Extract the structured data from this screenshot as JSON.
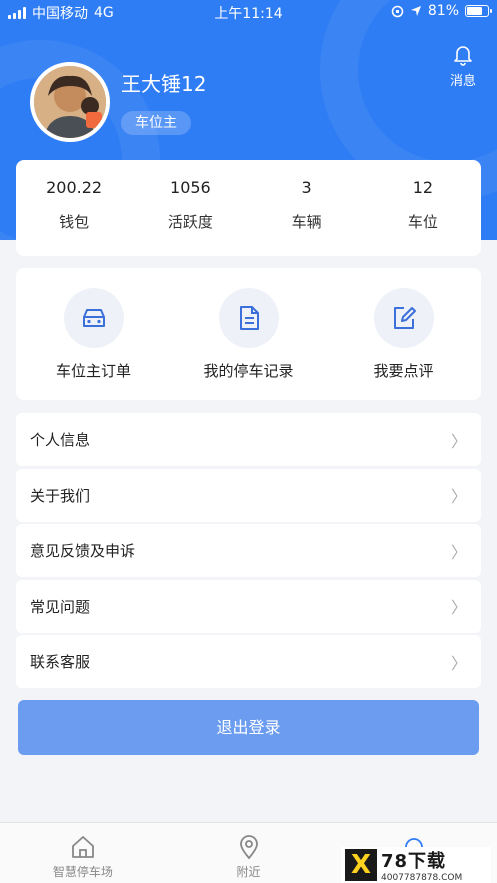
{
  "status_bar": {
    "carrier": "中国移动",
    "network": "4G",
    "time": "上午11:14",
    "battery_text": "81%",
    "battery_level": 0.81
  },
  "header": {
    "message_label": "消息",
    "username": "王大锤12",
    "role": "车位主"
  },
  "stats": [
    {
      "value": "200.22",
      "label": "钱包"
    },
    {
      "value": "1056",
      "label": "活跃度"
    },
    {
      "value": "3",
      "label": "车辆"
    },
    {
      "value": "12",
      "label": "车位"
    }
  ],
  "actions": [
    {
      "label": "车位主订单",
      "icon": "car-icon"
    },
    {
      "label": "我的停车记录",
      "icon": "document-icon"
    },
    {
      "label": "我要点评",
      "icon": "edit-icon"
    }
  ],
  "menu": [
    {
      "label": "个人信息"
    },
    {
      "label": "关于我们"
    },
    {
      "label": "意见反馈及申诉"
    },
    {
      "label": "常见问题"
    },
    {
      "label": "联系客服"
    }
  ],
  "logout_label": "退出登录",
  "tabbar": [
    {
      "label": "智慧停车场",
      "icon": "home-icon"
    },
    {
      "label": "附近",
      "icon": "location-pin-icon"
    },
    {
      "label": "",
      "icon": "profile-icon"
    }
  ],
  "watermark": {
    "brand": "78下载",
    "site": "4007787878.COM"
  },
  "colors": {
    "primary": "#2f7df4",
    "logout": "#6b9cf0",
    "background": "#f3f4f8"
  }
}
